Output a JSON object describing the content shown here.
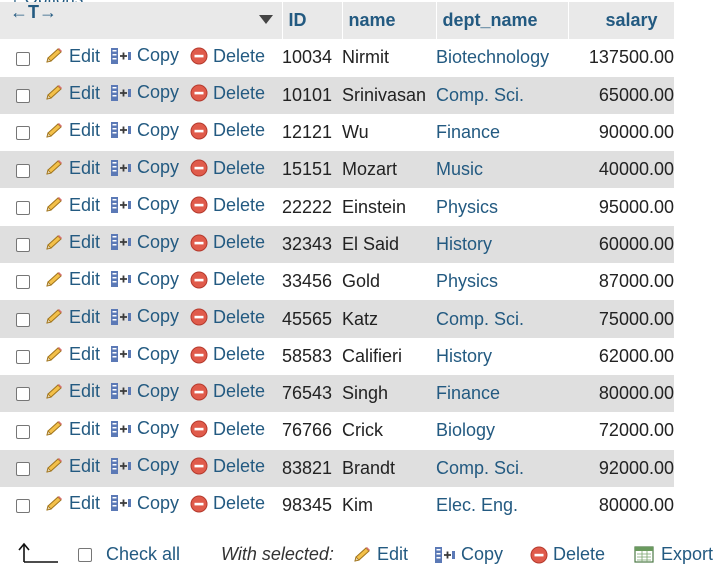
{
  "options": {
    "label": "+ Options"
  },
  "columns_control": {
    "label": "←T→"
  },
  "headers": {
    "id": "ID",
    "name": "name",
    "dept_name": "dept_name",
    "salary": "salary"
  },
  "actions": {
    "edit": "Edit",
    "copy": "Copy",
    "delete": "Delete"
  },
  "rows": [
    {
      "id": "10034",
      "name": "Nirmit",
      "dept_name": "Biotechnology",
      "salary": "137500.00"
    },
    {
      "id": "10101",
      "name": "Srinivasan",
      "dept_name": "Comp. Sci.",
      "salary": "65000.00"
    },
    {
      "id": "12121",
      "name": "Wu",
      "dept_name": "Finance",
      "salary": "90000.00"
    },
    {
      "id": "15151",
      "name": "Mozart",
      "dept_name": "Music",
      "salary": "40000.00"
    },
    {
      "id": "22222",
      "name": "Einstein",
      "dept_name": "Physics",
      "salary": "95000.00"
    },
    {
      "id": "32343",
      "name": "El Said",
      "dept_name": "History",
      "salary": "60000.00"
    },
    {
      "id": "33456",
      "name": "Gold",
      "dept_name": "Physics",
      "salary": "87000.00"
    },
    {
      "id": "45565",
      "name": "Katz",
      "dept_name": "Comp. Sci.",
      "salary": "75000.00"
    },
    {
      "id": "58583",
      "name": "Califieri",
      "dept_name": "History",
      "salary": "62000.00"
    },
    {
      "id": "76543",
      "name": "Singh",
      "dept_name": "Finance",
      "salary": "80000.00"
    },
    {
      "id": "76766",
      "name": "Crick",
      "dept_name": "Biology",
      "salary": "72000.00"
    },
    {
      "id": "83821",
      "name": "Brandt",
      "dept_name": "Comp. Sci.",
      "salary": "92000.00"
    },
    {
      "id": "98345",
      "name": "Kim",
      "dept_name": "Elec. Eng.",
      "salary": "80000.00"
    }
  ],
  "footer": {
    "check_all": "Check all",
    "with_selected": "With selected:",
    "edit": "Edit",
    "copy": "Copy",
    "delete": "Delete",
    "export": "Export"
  },
  "colors": {
    "link": "#235a81",
    "row_alt": "#dfdfdf",
    "header_bg": "#e9e9e9"
  }
}
